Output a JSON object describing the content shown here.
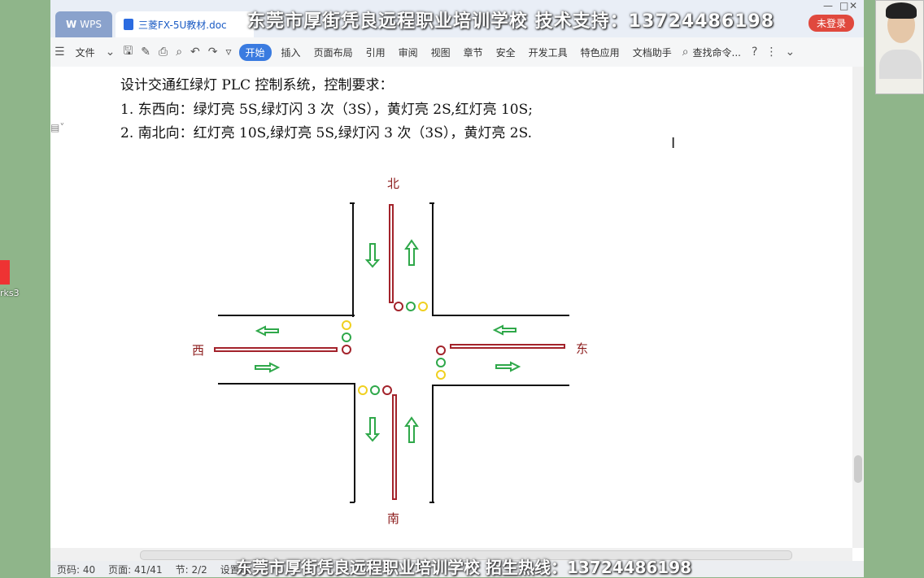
{
  "desktop": {
    "icon_label": "rks3"
  },
  "tabs": {
    "wps": "WPS",
    "doc": "三菱FX-5U教材.doc"
  },
  "watermark": {
    "top": "东莞市厚街凭良远程职业培训学校  技术支持：13724486198",
    "bottom": "东莞市厚街凭良远程职业培训学校  招生热线：13724486198"
  },
  "login": "未登录",
  "toolbar": {
    "file": "文件",
    "tabs": [
      "开始",
      "插入",
      "页面布局",
      "引用",
      "审阅",
      "视图",
      "章节",
      "安全",
      "开发工具",
      "特色应用",
      "文档助手"
    ],
    "active": "开始",
    "search": "查找命令..."
  },
  "doc": {
    "heading": "设计交通红绿灯 PLC 控制系统，控制要求：",
    "items": [
      "1.   东西向：绿灯亮 5S,绿灯闪 3 次（3S），黄灯亮 2S,红灯亮 10S;",
      "2.   南北向：红灯亮 10S,绿灯亮 5S,绿灯闪 3 次（3S），黄灯亮 2S."
    ],
    "labels": {
      "north": "北",
      "south": "南",
      "west": "西",
      "east": "东"
    }
  },
  "status": {
    "page": "页码: 40",
    "pages": "页面: 41/41",
    "section": "节: 2/2",
    "settings": "设置值"
  },
  "colors": {
    "red": "#a3232b",
    "green": "#2fa84a",
    "yellow": "#f0d020",
    "accent": "#3a7be0"
  }
}
